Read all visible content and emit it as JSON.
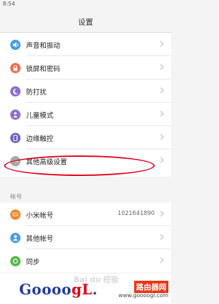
{
  "status_bar": {
    "time": "8:54"
  },
  "header": {
    "title": "设置"
  },
  "group1": {
    "items": [
      {
        "label": "声音和振动",
        "icon": "sound-icon",
        "color": "#4a9ee3"
      },
      {
        "label": "锁屏和密码",
        "icon": "lock-icon",
        "color": "#ef6a48"
      },
      {
        "label": "防打扰",
        "icon": "moon-icon",
        "color": "#8c6fd1"
      },
      {
        "label": "儿童模式",
        "icon": "child-mode-icon",
        "color": "#8c6fd1"
      },
      {
        "label": "边缘触控",
        "icon": "edge-touch-icon",
        "color": "#6a63c4"
      },
      {
        "label": "其他高级设置",
        "icon": "more-settings-icon",
        "color": "#a8a8a8"
      }
    ]
  },
  "accounts": {
    "section_label": "帐号",
    "items": [
      {
        "label": "小米帐号",
        "value": "1021641890",
        "icon": "mi-account-icon",
        "color": "#f58220"
      },
      {
        "label": "其他帐号",
        "value": "",
        "icon": "person-icon",
        "color": "#4a9ee3"
      },
      {
        "label": "同步",
        "value": "",
        "icon": "sync-icon",
        "color": "#55b94a"
      }
    ]
  },
  "watermark": {
    "baidu": "Bai du 经验",
    "logo_part1": "Goooo",
    "logo_part2": "gL",
    "logo_tail": ".",
    "site_name": "路由器网",
    "site_url": "www.goooogl.com"
  }
}
